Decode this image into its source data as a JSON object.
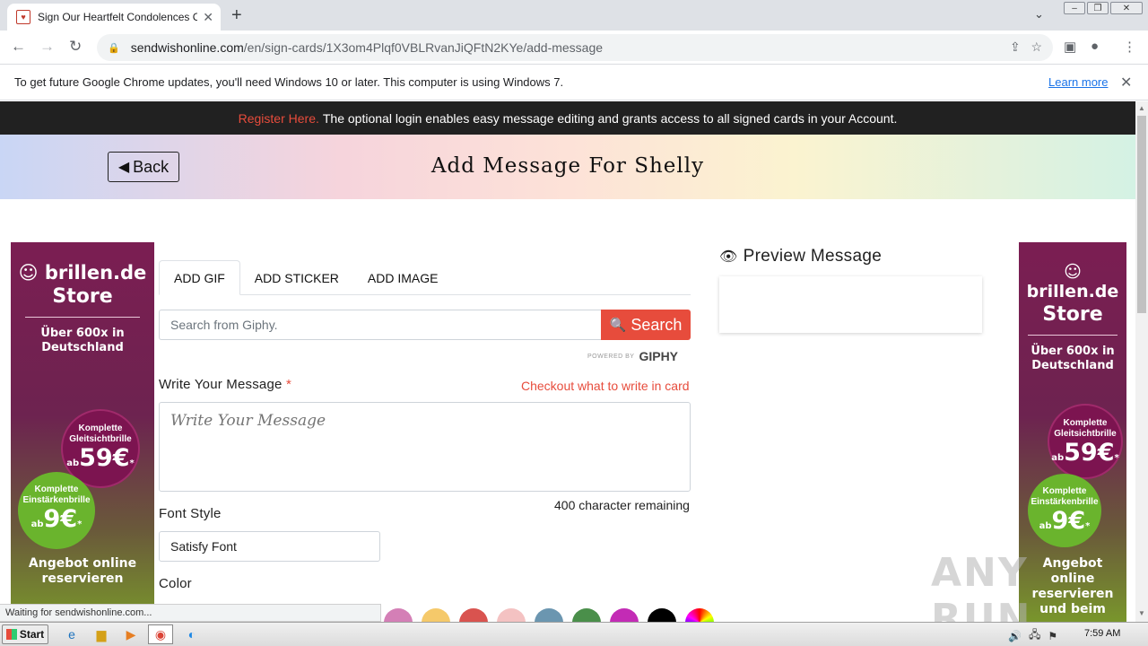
{
  "browser": {
    "tab_title": "Sign Our Heartfelt Condolences Card",
    "tab_favicon": "heart-icon",
    "url_domain": "sendwishonline.com",
    "url_path": "/en/sign-cards/1X3om4Plqf0VBLRvanJiQFtN2KYe/add-message",
    "status_text": "Waiting for sendwishonline.com..."
  },
  "infobar": {
    "message": "To get future Google Chrome updates, you'll need Windows 10 or later. This computer is using Windows 7.",
    "learn_more": "Learn more"
  },
  "page": {
    "register_link": "Register Here.",
    "register_text": "The optional login enables easy message editing and grants access to all signed cards in your Account.",
    "back_label": "Back",
    "heading": "Add Message For Shelly"
  },
  "form": {
    "tabs": [
      {
        "label": "ADD GIF",
        "active": true
      },
      {
        "label": "ADD STICKER",
        "active": false
      },
      {
        "label": "ADD IMAGE",
        "active": false
      }
    ],
    "search_placeholder": "Search from Giphy.",
    "search_button": "Search",
    "giphy_powered": "POWERED BY",
    "giphy_brand": "GIPHY",
    "message_label": "Write Your Message",
    "required_mark": "*",
    "checkout_link": "Checkout what to write in card",
    "message_placeholder": "Write Your Message",
    "chars_remaining": "400 character remaining",
    "font_style_label": "Font Style",
    "font_style_value": "Satisfy Font",
    "color_label": "Color",
    "colors": [
      "#d47fb6",
      "#f5c96a",
      "#d9534f",
      "#f4c2c2",
      "#6b96b0",
      "#4a8f4a",
      "#c32bb5",
      "#000000"
    ]
  },
  "preview": {
    "title": "Preview Message"
  },
  "ad": {
    "brand": "brillen.de",
    "store": "Store",
    "headline": "Über 600x in Deutschland",
    "offer1_text": "Komplette Gleitsichtbrille",
    "offer1_prefix": "ab",
    "offer1_price": "59€",
    "offer1_star": "*",
    "offer2_text": "Komplette Einstärkenbrille",
    "offer2_prefix": "ab",
    "offer2_price": "9€",
    "offer2_star": "*",
    "footer_left": "Angebot online reservieren",
    "footer_right": "Angebot online reservieren und beim"
  },
  "taskbar": {
    "start": "Start",
    "clock": "7:59 AM"
  },
  "watermark": "ANY RUN"
}
